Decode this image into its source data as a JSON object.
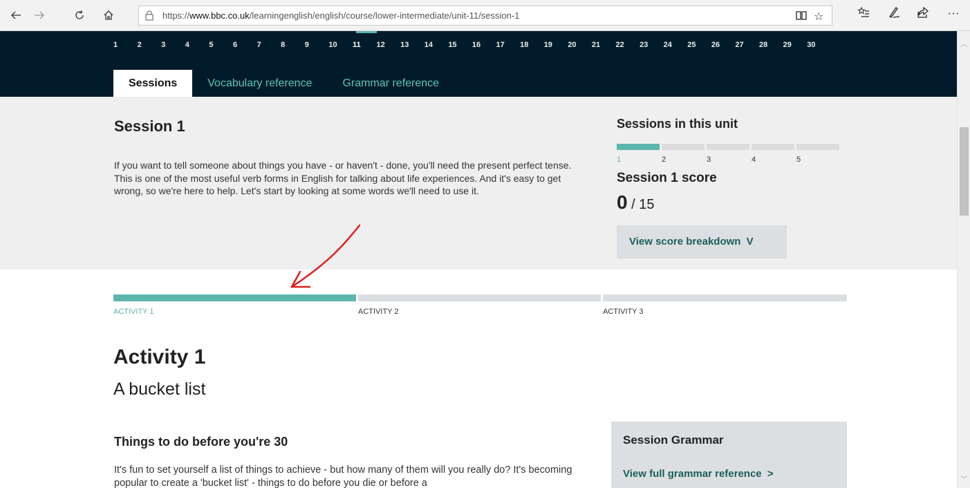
{
  "browser": {
    "url_prefix": "https://",
    "url_domain": "www.bbc.co.uk",
    "url_path": "/learningenglish/english/course/lower-intermediate/unit-11/session-1",
    "icons": [
      "back-arrow-icon",
      "forward-arrow-icon",
      "refresh-icon",
      "home-icon",
      "lock-icon",
      "reading-view-icon",
      "favorite-star-icon",
      "favorites-list-icon",
      "pen-icon",
      "share-icon",
      "more-icon"
    ],
    "more_label": "···"
  },
  "header": {
    "units": [
      "1",
      "2",
      "3",
      "4",
      "5",
      "6",
      "7",
      "8",
      "9",
      "10",
      "11",
      "12",
      "13",
      "14",
      "15",
      "16",
      "17",
      "18",
      "19",
      "20",
      "21",
      "22",
      "23",
      "24",
      "25",
      "26",
      "27",
      "28",
      "29",
      "30"
    ],
    "active_unit": "11",
    "tabs": [
      {
        "label": "Sessions",
        "active": true
      },
      {
        "label": "Vocabulary reference",
        "active": false
      },
      {
        "label": "Grammar reference",
        "active": false
      }
    ]
  },
  "session": {
    "title": "Session 1",
    "description": "If you want to tell someone about things you have - or haven't - done, you'll need the present perfect tense. This is one of the most useful verb forms in English for talking about life experiences. And it's easy to get wrong, so we're here to help. Let's start by looking at some words we'll need to use it.",
    "sessions_in_unit_title": "Sessions in this unit",
    "sessions": [
      "1",
      "2",
      "3",
      "4",
      "5"
    ],
    "active_session": "1",
    "score_title": "Session 1 score",
    "score": "0",
    "score_total": "/ 15",
    "breakdown_label": "View score breakdown",
    "breakdown_chevron": "V"
  },
  "activities": {
    "items": [
      {
        "label": "ACTIVITY 1",
        "active": true
      },
      {
        "label": "ACTIVITY 2",
        "active": false
      },
      {
        "label": "ACTIVITY 3",
        "active": false
      }
    ]
  },
  "activity": {
    "title": "Activity 1",
    "subtitle": "A bucket list",
    "section_title": "Things to do before you're 30",
    "body": "It's fun to set yourself a list of things to achieve - but how many of them will you really do? It's becoming popular to create a  'bucket list' - things to do before you die or before a"
  },
  "grammar": {
    "title": "Session Grammar",
    "link": "View full grammar reference",
    "link_chevron": ">"
  },
  "colors": {
    "dark_header": "#021b2a",
    "accent_teal": "#5bb6ae",
    "tab_text": "#5bc4bb",
    "panel_gray": "#efefef",
    "button_gray": "#dcdfe1",
    "link_green": "#1a5f5a",
    "annotation_red": "#e0201c"
  }
}
